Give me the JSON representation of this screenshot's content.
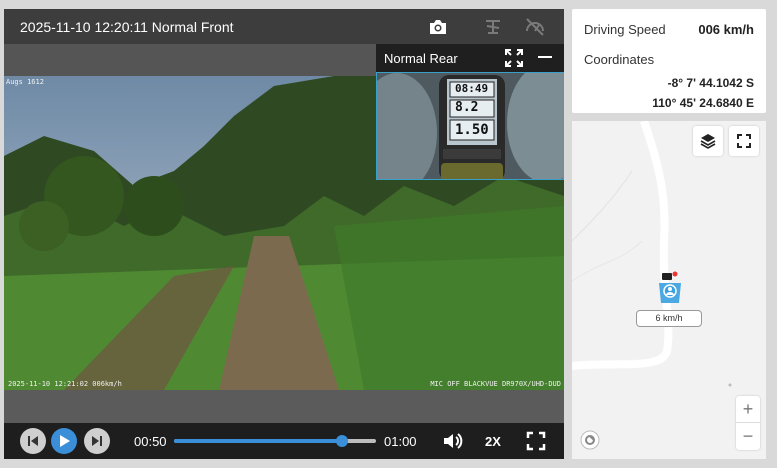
{
  "player": {
    "title": "2025-11-10 12:20:11 Normal Front",
    "overlay_top_left": "Augs 1612",
    "overlay_bottom_left": "2025-11-10 12:21:02 006km/h",
    "overlay_bottom_right": "MIC OFF BLACKVUE DR970X/UHD-DUD",
    "rear": {
      "label": "Normal Rear",
      "gps_time": "08:49",
      "gps_speed": "8.2",
      "gps_odo": "1.50"
    },
    "controls": {
      "current_time": "00:50",
      "end_time": "01:00",
      "progress": 0.83,
      "speed_label": "2X"
    }
  },
  "info": {
    "speed_label": "Driving Speed",
    "speed_value": "006 km/h",
    "coords_label": "Coordinates",
    "latitude": "-8° 7' 44.1042 S",
    "longitude": "110° 45' 24.6840 E"
  },
  "map": {
    "marker_speed": "6 km/h",
    "zoom_in": "+",
    "zoom_out": "−"
  },
  "colors": {
    "accent": "#3a8fd8",
    "pip_border": "#3aa0c8",
    "marker": "#3aa0e0"
  }
}
